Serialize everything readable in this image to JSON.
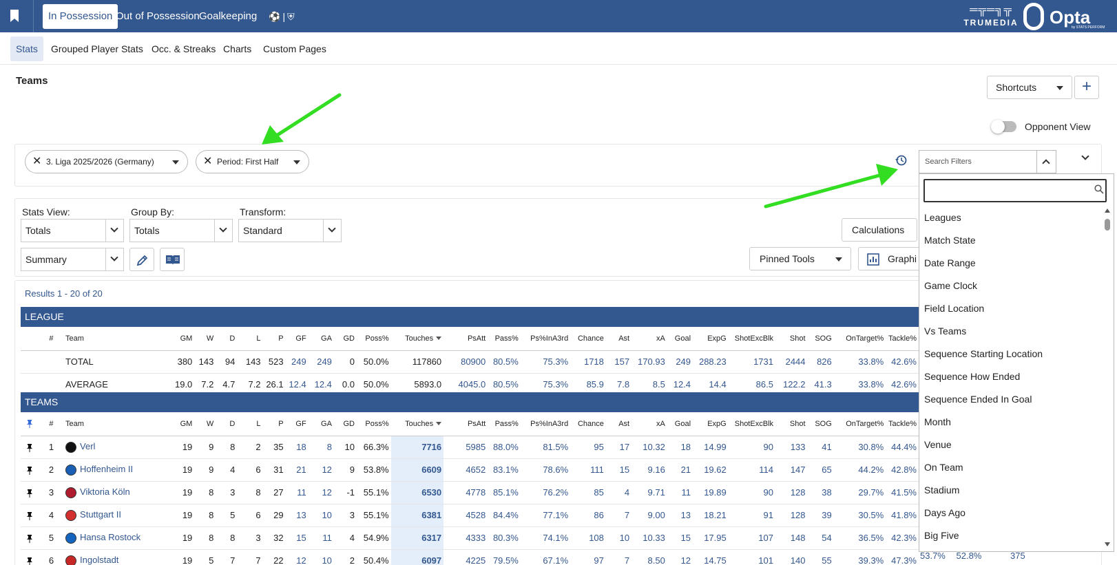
{
  "topnav": {
    "tabs": [
      {
        "label": "In Possession",
        "active": true
      },
      {
        "label": "Out of Possession",
        "active": false
      },
      {
        "label": "Goalkeeping",
        "active": false
      }
    ],
    "brand_left": "TRUMEDIA",
    "brand_right": "Opta",
    "brand_right_sub": "by STATS PERFORM"
  },
  "subnav": {
    "tabs": [
      {
        "label": "Stats",
        "active": true
      },
      {
        "label": "Grouped Player Stats",
        "active": false
      },
      {
        "label": "Occ. & Streaks",
        "active": false
      },
      {
        "label": "Charts",
        "active": false
      },
      {
        "label": "Custom Pages",
        "active": false
      }
    ]
  },
  "page": {
    "title": "Teams",
    "shortcuts_label": "Shortcuts",
    "plus_label": "+",
    "opponent_view_label": "Opponent View",
    "opponent_view_on": false
  },
  "filters": {
    "chips": [
      {
        "label": "3. Liga 2025/2026 (Germany)"
      },
      {
        "label": "Period: First Half"
      }
    ],
    "search_placeholder": "Search Filters",
    "dropdown_items": [
      "Leagues",
      "Match State",
      "Date Range",
      "Game Clock",
      "Field Location",
      "Vs Teams",
      "Sequence Starting Location",
      "Sequence How Ended",
      "Sequence Ended In Goal",
      "Month",
      "Venue",
      "On Team",
      "Stadium",
      "Days Ago",
      "Big Five"
    ]
  },
  "controls": {
    "stats_view_label": "Stats View:",
    "stats_view_value": "Totals",
    "group_by_label": "Group By:",
    "group_by_value": "Totals",
    "transform_label": "Transform:",
    "transform_value": "Standard",
    "summary_value": "Summary",
    "calculations_label": "Calculations",
    "pinned_tools_label": "Pinned Tools",
    "graphics_label": "Graphi"
  },
  "results": {
    "count_text": "Results 1 - 20 of 20",
    "league_header": "LEAGUE",
    "teams_header": "TEAMS",
    "columns": [
      "#",
      "Team",
      "GM",
      "W",
      "D",
      "L",
      "P",
      "GF",
      "GA",
      "GD",
      "Poss%",
      "Touches",
      "PsAtt",
      "Pass%",
      "Ps%InA3rd",
      "Chance",
      "Ast",
      "xA",
      "Goal",
      "ExpG",
      "ShotExcBlk",
      "Shot",
      "SOG",
      "OnTarget%",
      "Tackle%"
    ],
    "league_rows": [
      [
        "",
        "TOTAL",
        "380",
        "143",
        "94",
        "143",
        "523",
        "249",
        "249",
        "0",
        "50.0%",
        "117860",
        "80900",
        "80.5%",
        "75.3%",
        "1718",
        "157",
        "170.93",
        "249",
        "288.23",
        "1731",
        "2444",
        "826",
        "33.8%",
        "42.6%"
      ],
      [
        "",
        "AVERAGE",
        "19.0",
        "7.2",
        "4.7",
        "7.2",
        "26.1",
        "12.4",
        "12.4",
        "0.0",
        "50.0%",
        "5893.0",
        "4045.0",
        "80.5%",
        "75.3%",
        "85.9",
        "7.8",
        "8.5",
        "12.4",
        "14.4",
        "86.5",
        "122.2",
        "41.3",
        "33.8%",
        "42.6%"
      ]
    ],
    "team_rows": [
      [
        "1",
        "Verl",
        "19",
        "9",
        "8",
        "2",
        "35",
        "18",
        "8",
        "10",
        "66.3%",
        "7716",
        "5985",
        "88.0%",
        "81.5%",
        "95",
        "17",
        "10.32",
        "18",
        "14.99",
        "90",
        "133",
        "41",
        "30.8%",
        "44.4%"
      ],
      [
        "2",
        "Hoffenheim II",
        "19",
        "9",
        "4",
        "6",
        "31",
        "21",
        "12",
        "9",
        "53.8%",
        "6609",
        "4652",
        "83.1%",
        "78.6%",
        "111",
        "15",
        "9.16",
        "21",
        "19.62",
        "114",
        "147",
        "65",
        "44.2%",
        "42.8%"
      ],
      [
        "3",
        "Viktoria Köln",
        "19",
        "8",
        "3",
        "8",
        "27",
        "11",
        "12",
        "-1",
        "55.1%",
        "6530",
        "4778",
        "85.1%",
        "76.2%",
        "85",
        "4",
        "9.71",
        "11",
        "19.89",
        "90",
        "128",
        "38",
        "29.7%",
        "41.5%"
      ],
      [
        "4",
        "Stuttgart II",
        "19",
        "8",
        "5",
        "6",
        "29",
        "13",
        "10",
        "3",
        "55.1%",
        "6381",
        "4528",
        "84.4%",
        "77.1%",
        "86",
        "7",
        "9.00",
        "13",
        "18.21",
        "91",
        "128",
        "39",
        "30.5%",
        "41.8%"
      ],
      [
        "5",
        "Hansa Rostock",
        "19",
        "8",
        "8",
        "3",
        "32",
        "15",
        "11",
        "4",
        "54.9%",
        "6317",
        "4333",
        "80.3%",
        "74.1%",
        "108",
        "10",
        "10.33",
        "15",
        "17.95",
        "107",
        "148",
        "54",
        "36.5%",
        "42.3%"
      ],
      [
        "6",
        "Ingolstadt",
        "19",
        "5",
        "7",
        "7",
        "22",
        "12",
        "10",
        "2",
        "50.4%",
        "6097",
        "4225",
        "79.5%",
        "67.1%",
        "97",
        "7",
        "8.50",
        "12",
        "14.75",
        "101",
        "140",
        "55",
        "39.3%",
        "47.3%"
      ]
    ],
    "row6_extra": [
      "53.7%",
      "52.8%",
      "375"
    ],
    "team_logo_colors": [
      "#111111",
      "#1a5fb4",
      "#b01c2e",
      "#d32f2f",
      "#1565c0",
      "#c62828"
    ]
  },
  "colors": {
    "primary": "#33578f",
    "highlight_column": "#e3eefa",
    "annotation_arrow": "#33dd22"
  }
}
